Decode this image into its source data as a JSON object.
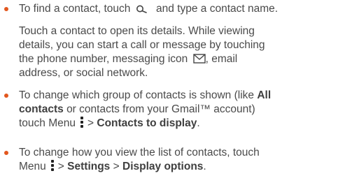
{
  "bullets": {
    "b1": {
      "before": "To find a contact, touch",
      "after": "and type a contact name."
    },
    "p1": {
      "l1": "Touch a contact to open its details. While viewing",
      "l2": "details, you can start a call or message by touching",
      "l3a": "the phone number, messaging icon",
      "l3b": ", email",
      "l4": "address, or social network."
    },
    "b2": {
      "l1a": "To change which group of contacts is shown (like",
      "l1b": "All",
      "l2a": "contacts",
      "l2b": "or contacts from your Gmail™ account)",
      "l3a": "touch Menu",
      "l3b": ">",
      "l3c": "Contacts to display",
      "l3d": "."
    },
    "b3": {
      "l1": "To change how you view the list of contacts, touch",
      "l2a": "Menu",
      "l2b": ">",
      "l2c": "Settings",
      "l2d": ">",
      "l2e": "Display options",
      "l2f": "."
    }
  },
  "icons": [
    "search-icon",
    "message-icon",
    "menu-icon"
  ],
  "colors": {
    "bullet": "#e2571e",
    "text": "#4a4a4a"
  }
}
